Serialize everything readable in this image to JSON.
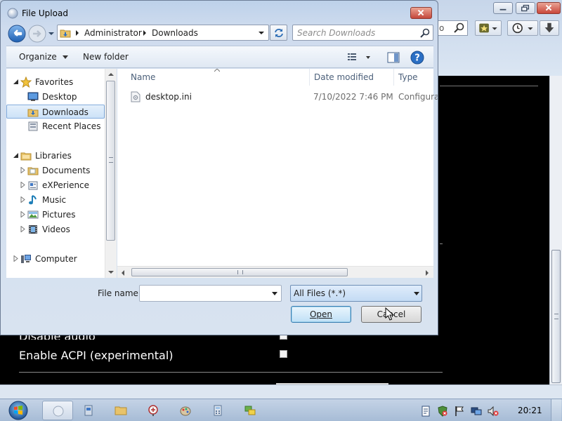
{
  "browser": {
    "address_fragment": "o",
    "content": {
      "audio_label": "Disable audio",
      "audio_checked": false,
      "acpi_label": "Enable ACPI (experimental)",
      "acpi_checked": false
    }
  },
  "dialog": {
    "title": "File Upload",
    "breadcrumb": [
      "Administrator",
      "Downloads"
    ],
    "search_placeholder": "Search Downloads",
    "toolbar": {
      "organize_label": "Organize",
      "new_folder_label": "New folder"
    },
    "nav": {
      "favorites": {
        "label": "Favorites",
        "items": [
          {
            "label": "Desktop",
            "icon": "desktop-icon"
          },
          {
            "label": "Downloads",
            "icon": "downloads-folder-icon",
            "selected": true
          },
          {
            "label": "Recent Places",
            "icon": "recent-places-icon"
          }
        ]
      },
      "libraries": {
        "label": "Libraries",
        "items": [
          {
            "label": "Documents",
            "icon": "documents-icon"
          },
          {
            "label": "eXPerience",
            "icon": "library-icon"
          },
          {
            "label": "Music",
            "icon": "music-icon"
          },
          {
            "label": "Pictures",
            "icon": "pictures-icon"
          },
          {
            "label": "Videos",
            "icon": "videos-icon"
          }
        ]
      },
      "computer": {
        "label": "Computer",
        "icon": "computer-icon"
      }
    },
    "columns": [
      "Name",
      "Date modified",
      "Type"
    ],
    "files": [
      {
        "name": "desktop.ini",
        "date_modified": "7/10/2022 7:46 PM",
        "type": "Configura",
        "icon": "settings-file-icon"
      }
    ],
    "file_name_label": "File name:",
    "file_name_value": "",
    "file_type_value": "All Files (*.*)",
    "open_label": "Open",
    "cancel_label": "Cancel"
  },
  "taskbar": {
    "clock": "20:21",
    "apps": [
      "dialog-app-icon",
      "app-icon-2",
      "folder-app-icon",
      "paint-app-icon",
      "app-icon-5",
      "calculator-app-icon",
      "app-icon-7"
    ]
  },
  "colors": {
    "dialog_frame": "#cfdcee",
    "selection": "#cce2f8",
    "close_button": "#c4473b",
    "browser_content_bg": "#000000"
  }
}
